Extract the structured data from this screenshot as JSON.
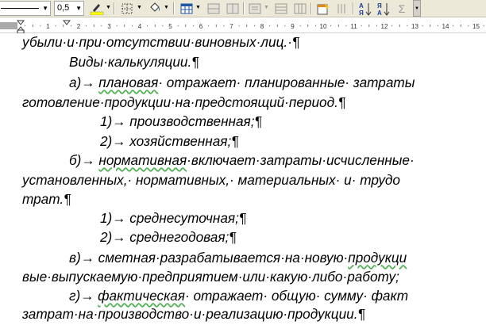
{
  "toolbar": {
    "style_value": "",
    "size_value": "0,5",
    "font_color": "#ffff00",
    "icons": [
      "line-style",
      "border-width",
      "highlight",
      "borders",
      "fill-color",
      "table",
      "table-merge",
      "table-split",
      "align",
      "distribute-rows",
      "distribute-cols",
      "autoformat",
      "text-direction",
      "sort-ascending",
      "sort-descending",
      "autosum"
    ],
    "sum_glyph": "Σ",
    "sort_glyph": "A\nЯ"
  },
  "ruler": {
    "marks": [
      "1",
      "2",
      "3",
      "4",
      "5",
      "6",
      "7",
      "8",
      "9",
      "10",
      "11",
      "12",
      "13",
      "14",
      "15"
    ]
  },
  "document": {
    "lines": [
      {
        "text": "убыли·и·при·отсутствии·виновных·лиц.·¶"
      },
      {
        "text": "Виды·калькуляции.¶"
      },
      {
        "pre": "а)→ ",
        "u": "плановая",
        "post": "· отражает· планированные· затраты"
      },
      {
        "text": "готовление·продукции·на·предстоящий·период.¶"
      },
      {
        "text": "1)→  производственная;¶"
      },
      {
        "text": "2)→  хозяйственная;¶"
      },
      {
        "pre": "б)→ ",
        "u": "нормативная",
        "post": "·включает·затраты·исчисленные·"
      },
      {
        "text": "установленных,· нормативных,· материальных· и· трудо"
      },
      {
        "text": "трат.¶"
      },
      {
        "text": "1)→  среднесуточная;¶"
      },
      {
        "text": "2)→  среднегодовая;¶"
      },
      {
        "pre": "в)→ ",
        "text2": "сметная·разрабатывается·на·новую·",
        "u": "продукци"
      },
      {
        "text": "вые·выпускаемую·предприятием·или·какую·либо·работу;"
      },
      {
        "pre": "г)→ ",
        "u": "фактическая",
        "post": "· отражает· общую· сумму· факт"
      },
      {
        "text": "затрат·на·производство·и·реализацию·продукции.¶"
      }
    ]
  }
}
